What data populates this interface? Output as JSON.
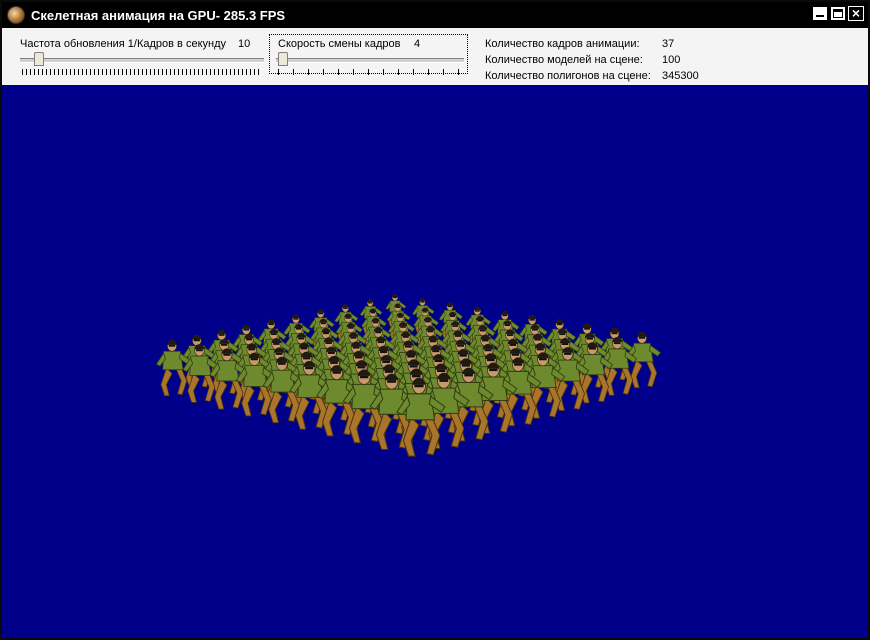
{
  "window": {
    "title": "Скелетная анимация на GPU- 285.3 FPS"
  },
  "controls": {
    "update_rate": {
      "label": "Частота обновления 1/Кадров в секунду",
      "value": "10",
      "level": 0.05
    },
    "frame_speed": {
      "label": "Скорость смены кадров",
      "value": "4",
      "level": 0.0
    }
  },
  "stats": [
    {
      "label": "Количество кадров анимации:",
      "value": "37"
    },
    {
      "label": "Количество моделей на сцене:",
      "value": "100"
    },
    {
      "label": "Количество полигонов на сцене:",
      "value": "345300"
    }
  ],
  "scene": {
    "background_color": "#00008b",
    "model_color": "#6e8a2e",
    "pants_color": "#a8752a",
    "grid": [
      10,
      10
    ]
  }
}
